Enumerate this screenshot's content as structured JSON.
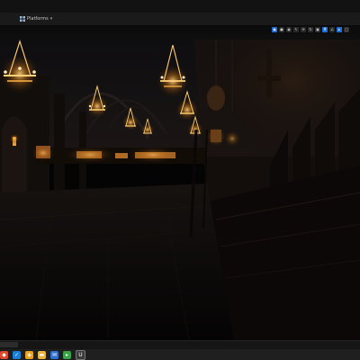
{
  "toolbar": {
    "platforms_label": "Platforms",
    "platforms_icon": "grid-icon"
  },
  "viewport_tools": [
    {
      "icon": "perspective-icon",
      "active": true
    },
    {
      "icon": "lit-mode-icon",
      "active": false
    },
    {
      "icon": "show-icon",
      "active": false
    },
    {
      "icon": "select-icon",
      "active": false
    },
    {
      "icon": "translate-icon",
      "active": false
    },
    {
      "icon": "rotate-icon",
      "active": false
    },
    {
      "icon": "scale-icon",
      "active": false
    },
    {
      "icon": "grid-snap-icon",
      "active": true
    },
    {
      "icon": "rotation-snap-icon",
      "active": false
    },
    {
      "icon": "camera-speed-icon",
      "active": true
    },
    {
      "icon": "maximize-icon",
      "active": false
    }
  ],
  "taskbar": {
    "icons": [
      "start-icon",
      "edge-icon",
      "shield-icon",
      "folder-icon",
      "mail-icon",
      "terminal-icon",
      "unreal-editor-icon"
    ],
    "colors": {
      "start": "#e2462b",
      "edge": "#1b7fd6",
      "shield": "#e9a21c",
      "folder": "#e9b43c",
      "mail": "#2d6fd2",
      "terminal": "#3aa34a",
      "unreal": "#3b3b3b"
    }
  },
  "colors": {
    "accent": "#1e6fd9",
    "candle": "#ffb347",
    "background": "#060505"
  }
}
